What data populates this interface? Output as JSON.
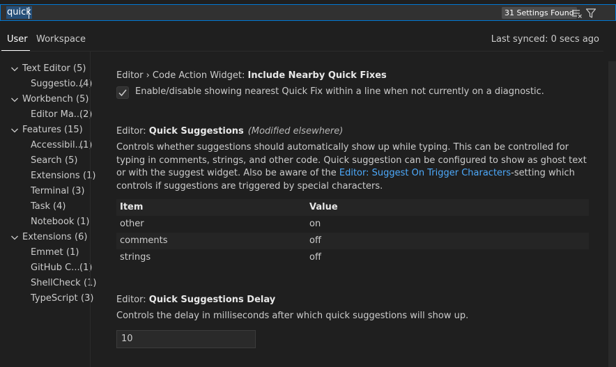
{
  "search": {
    "query": "quick",
    "results_count": "31 Settings Found"
  },
  "tabs": {
    "user": "User",
    "workspace": "Workspace"
  },
  "sync_status": "Last synced: 0 secs ago",
  "toc": [
    {
      "label": "Text Editor",
      "count": "(5)",
      "level": 0
    },
    {
      "label": "Suggestio...",
      "count": "(4)",
      "level": 1
    },
    {
      "label": "Workbench",
      "count": "(5)",
      "level": 0
    },
    {
      "label": "Editor Ma...",
      "count": "(2)",
      "level": 1
    },
    {
      "label": "Features",
      "count": "(15)",
      "level": 0
    },
    {
      "label": "Accessibil...",
      "count": "(1)",
      "level": 1
    },
    {
      "label": "Search",
      "count": "(5)",
      "level": 1
    },
    {
      "label": "Extensions",
      "count": "(1)",
      "level": 1
    },
    {
      "label": "Terminal",
      "count": "(3)",
      "level": 1
    },
    {
      "label": "Task",
      "count": "(4)",
      "level": 1
    },
    {
      "label": "Notebook",
      "count": "(1)",
      "level": 1
    },
    {
      "label": "Extensions",
      "count": "(6)",
      "level": 0
    },
    {
      "label": "Emmet",
      "count": "(1)",
      "level": 1
    },
    {
      "label": "GitHub C...",
      "count": "(1)",
      "level": 1
    },
    {
      "label": "ShellCheck",
      "count": "(1)",
      "level": 1
    },
    {
      "label": "TypeScript",
      "count": "(3)",
      "level": 1
    }
  ],
  "settings": {
    "nearby_quick_fixes": {
      "category": "Editor › Code Action Widget: ",
      "name": "Include Nearby Quick Fixes",
      "checkbox_label": "Enable/disable showing nearest Quick Fix within a line when not currently on a diagnostic.",
      "checked": true
    },
    "quick_suggestions": {
      "category": "Editor: ",
      "name": "Quick Suggestions",
      "modified": "(Modified elsewhere)",
      "desc_before": "Controls whether suggestions should automatically show up while typing. This can be controlled for typing in comments, strings, and other code. Quick suggestion can be configured to show as ghost text or with the suggest widget. Also be aware of the ",
      "desc_link": "Editor: Suggest On Trigger Characters",
      "desc_after": "-setting which controls if suggestions are triggered by special characters.",
      "table_headers": {
        "item": "Item",
        "value": "Value"
      },
      "rows": [
        {
          "item": "other",
          "value": "on"
        },
        {
          "item": "comments",
          "value": "off"
        },
        {
          "item": "strings",
          "value": "off"
        }
      ]
    },
    "quick_suggestions_delay": {
      "category": "Editor: ",
      "name": "Quick Suggestions Delay",
      "desc": "Controls the delay in milliseconds after which quick suggestions will show up.",
      "value": "10"
    }
  },
  "colors": {
    "accent": "#0078d4",
    "link": "#4daafc",
    "background": "#1f1f1f"
  }
}
